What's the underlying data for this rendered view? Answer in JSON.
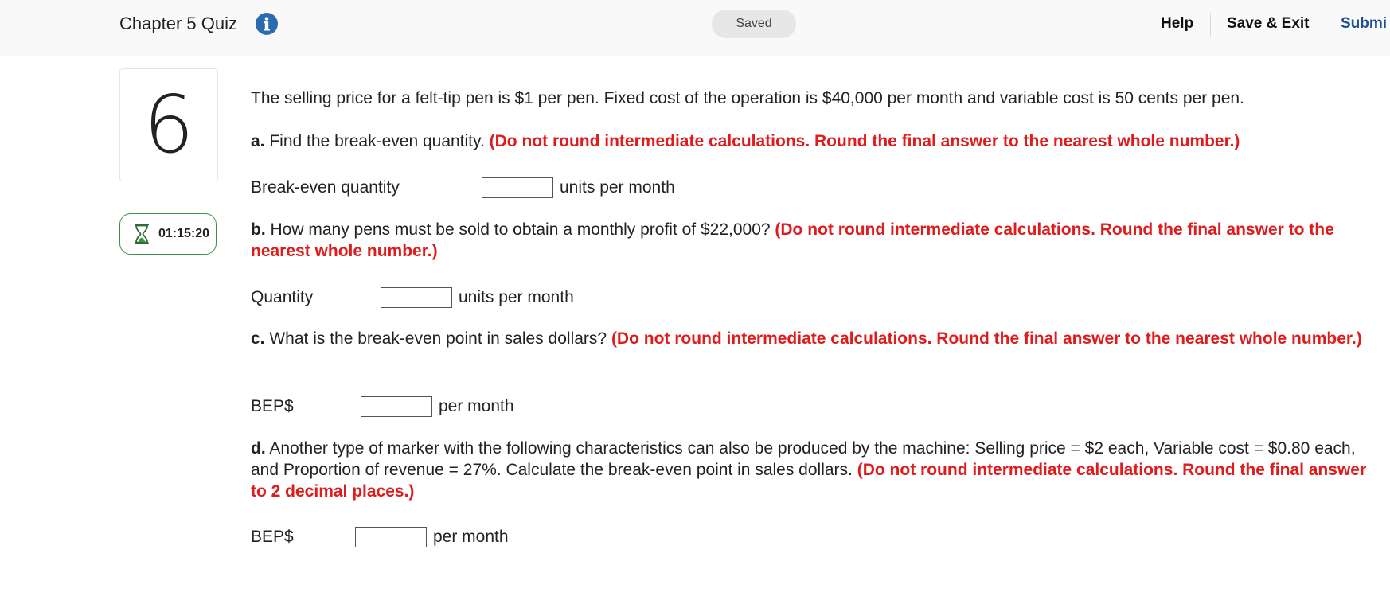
{
  "header": {
    "quiz_title": "Chapter 5 Quiz",
    "saved_label": "Saved",
    "help_label": "Help",
    "save_exit_label": "Save & Exit",
    "submit_label": "Submi",
    "info_icon": "info-circle-icon"
  },
  "question": {
    "number": "6",
    "timer": "01:15:20",
    "timer_icon": "hourglass-icon",
    "intro": "The selling price for a felt-tip pen is $1 per pen. Fixed cost of the operation is $40,000 per month and variable cost is 50 cents per pen.",
    "parts": [
      {
        "letter": "a.",
        "text": "Find the break-even quantity.",
        "instruction": "(Do not round intermediate calculations. Round the final answer to the nearest whole number.)",
        "field_label": "Break-even quantity",
        "field_value": "",
        "unit": "units per month"
      },
      {
        "letter": "b.",
        "text": "How many pens must be sold to obtain a monthly profit of $22,000?",
        "instruction": "(Do not round intermediate calculations. Round the final answer to the nearest whole number.)",
        "field_label": "Quantity",
        "field_value": "",
        "unit": "units per month"
      },
      {
        "letter": "c.",
        "text": "What is the break-even point in sales dollars?",
        "instruction": "(Do not round intermediate calculations. Round the final answer to the nearest whole number.)",
        "field_label": "BEP$",
        "field_value": "",
        "unit": "per month"
      },
      {
        "letter": "d.",
        "text": "Another type of marker with the following characteristics can also be produced by the machine: Selling price = $2 each, Variable cost = $0.80 each, and Proportion of revenue = 27%. Calculate the break-even point in sales dollars.",
        "instruction": "(Do not round intermediate calculations. Round the final answer to 2 decimal places.)",
        "field_label": "BEP$",
        "field_value": "",
        "unit": "per month"
      }
    ]
  },
  "colors": {
    "instruction_red": "#e01b1b",
    "submit_blue": "#1e4f92",
    "info_blue": "#2b6cb0",
    "timer_green": "#3f8f4a"
  }
}
